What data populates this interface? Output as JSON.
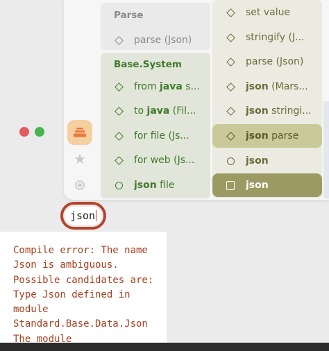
{
  "window": {
    "controls": [
      "close",
      "maximize"
    ]
  },
  "sidebar": {
    "icons": [
      {
        "name": "stack-icon",
        "active": true
      },
      {
        "name": "star-icon",
        "active": false
      },
      {
        "name": "target-icon",
        "active": false
      }
    ]
  },
  "palette": {
    "left_column": {
      "groups": [
        {
          "title": "Parse",
          "items": [
            {
              "icon": "diamond-icon",
              "prefix": "",
              "label": "parse (Json)"
            }
          ]
        },
        {
          "title": "Base.System",
          "items": [
            {
              "icon": "diamond-icon",
              "prefix": "from ",
              "keyword": "java",
              "label": " s..."
            },
            {
              "icon": "diamond-icon",
              "prefix": "to ",
              "keyword": "java",
              "label": " (Fil..."
            },
            {
              "icon": "diamond-icon",
              "prefix": "for file (Js...",
              "keyword": "",
              "label": ""
            },
            {
              "icon": "diamond-icon",
              "prefix": "for web (Js...",
              "keyword": "",
              "label": ""
            },
            {
              "icon": "circle-icon",
              "prefix": "",
              "keyword": "json",
              "label": " file"
            }
          ]
        }
      ]
    },
    "right_column": {
      "items": [
        {
          "icon": "diamond-icon",
          "keyword": "",
          "label": "set value",
          "state": "normal"
        },
        {
          "icon": "diamond-icon",
          "keyword": "",
          "label": "stringify (J...",
          "state": "normal"
        },
        {
          "icon": "diamond-icon",
          "keyword": "",
          "label": "parse (Json)",
          "state": "normal"
        },
        {
          "icon": "diamond-icon",
          "keyword": "json",
          "label": " (Mars...",
          "state": "normal"
        },
        {
          "icon": "diamond-icon",
          "keyword": "json",
          "label": " stringi...",
          "state": "normal"
        },
        {
          "icon": "diamond-icon",
          "keyword": "json",
          "label": " parse",
          "state": "hover"
        },
        {
          "icon": "circle-icon",
          "keyword": "json",
          "label": "",
          "state": "normal"
        },
        {
          "icon": "square-icon",
          "keyword": "json",
          "label": "",
          "state": "selected"
        }
      ]
    }
  },
  "search": {
    "value": "json"
  },
  "error": {
    "message": "Compile error: The name Json is ambiguous. Possible candidates are: Type Json defined in module Standard.Base.Data.Json The module"
  },
  "colors": {
    "accent_orange": "#f5cfa0",
    "error_red": "#a5401e",
    "group_green": "#3f7a2a",
    "selected_olive": "#9b9a62",
    "hover_olive": "#c9c99a"
  }
}
